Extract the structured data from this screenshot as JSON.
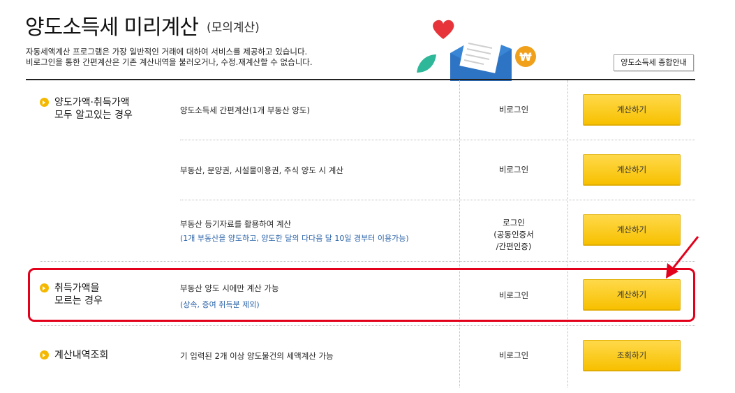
{
  "header": {
    "title": "양도소득세 미리계산",
    "subtitle": "(모의계산)",
    "desc_line1": "자동세액계산 프로그램은 가장 일반적인 거래에 대하여 서비스를 제공하고 있습니다.",
    "desc_line2": "비로그인을 통한 간편계산은 기존 계산내역을 불러오거나, 수정.재계산할 수 없습니다.",
    "guide_button": "양도소득세 종합안내"
  },
  "categories": [
    {
      "label": "양도가액·취득가액\n모두 알고있는 경우"
    },
    {
      "label": "취득가액을\n모르는 경우"
    },
    {
      "label": "계산내역조회"
    }
  ],
  "rows": [
    {
      "item": "양도소득세 간편계산(1개 부동산 양도)",
      "note": "",
      "login": "비로그인",
      "button": "계산하기"
    },
    {
      "item": "부동산, 분양권, 시설물이용권, 주식 양도 시 계산",
      "note": "",
      "login": "비로그인",
      "button": "계산하기"
    },
    {
      "item": "부동산 등기자료를 활용하여 계산",
      "note": "(1개 부동산을 양도하고, 양도한 달의 다다음 달 10일 경부터 이용가능)",
      "login": "로그인\n(공동인증서\n/간편인증)",
      "button": "계산하기"
    },
    {
      "item": "부동산 양도 시에만 계산 가능",
      "note": "(상속, 증여 취득분 제외)",
      "login": "비로그인",
      "button": "계산하기"
    },
    {
      "item": "기 입력된 2개 이상 양도물건의 세액계산 가능",
      "note": "",
      "login": "비로그인",
      "button": "조회하기"
    }
  ],
  "colors": {
    "accent_yellow": "#f7c000",
    "highlight_red": "#e3001b",
    "note_blue": "#2a62a8"
  },
  "icons": [
    "heart-icon",
    "envelope-icon",
    "won-coin-icon",
    "leaf-icon",
    "category-bullet-icon",
    "red-arrow-icon"
  ]
}
